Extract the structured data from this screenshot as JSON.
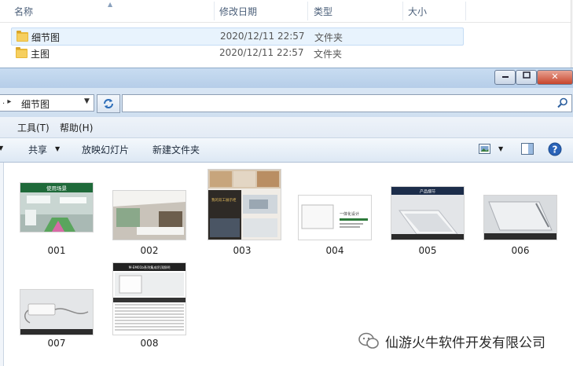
{
  "background_window": {
    "columns": {
      "name": "名称",
      "modified": "修改日期",
      "type": "类型",
      "size": "大小"
    },
    "rows": [
      {
        "name": "细节图",
        "modified": "2020/12/11 22:57",
        "type": "文件夹"
      },
      {
        "name": "主图",
        "modified": "2020/12/11 22:57",
        "type": "文件夹"
      }
    ]
  },
  "window": {
    "address": {
      "path": "细节图",
      "search_placeholder": ""
    },
    "menu": {
      "tools": "工具(T)",
      "help": "帮助(H)"
    },
    "commands": {
      "share": "共享",
      "slideshow": "放映幻灯片",
      "new_folder": "新建文件夹"
    },
    "files": [
      {
        "label": "001",
        "caption": "使用场景"
      },
      {
        "label": "002"
      },
      {
        "label": "003",
        "caption": "我的双工展示柜"
      },
      {
        "label": "004",
        "caption": "一体化设计"
      },
      {
        "label": "005",
        "caption": "产品细节"
      },
      {
        "label": "006"
      },
      {
        "label": "007"
      },
      {
        "label": "008",
        "caption": "M-EM01b系列集成吊顶照明"
      }
    ]
  },
  "watermark": {
    "text": "仙游火牛软件开发有限公司"
  },
  "colors": {
    "folder": "#e8b838",
    "titlebar": "#c8dcf1",
    "selection": "#e8f3fd",
    "close": "#c7452c"
  },
  "icons": [
    "folder-icon",
    "minimize-icon",
    "maximize-icon",
    "close-icon",
    "refresh-icon",
    "search-icon",
    "view-icon",
    "preview-pane-icon",
    "help-icon",
    "wechat-icon"
  ]
}
